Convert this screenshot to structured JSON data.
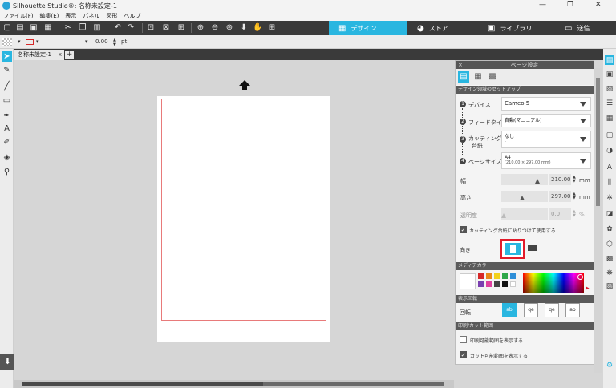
{
  "window": {
    "title": "Silhouette Studio®: 名称未設定-1",
    "minimize": "—",
    "restore": "❐",
    "close": "✕"
  },
  "menu": [
    "ファイル(F)",
    "編集(E)",
    "表示",
    "パネル",
    "図形",
    "ヘルプ"
  ],
  "nav_tabs": [
    {
      "label": "デザイン",
      "icon": "▦",
      "active": true
    },
    {
      "label": "ストア",
      "icon": "◕",
      "active": false
    },
    {
      "label": "ライブラリ",
      "icon": "▣",
      "active": false
    },
    {
      "label": "送信",
      "icon": "▭",
      "active": false
    }
  ],
  "options_bar": {
    "line_width": "0.00",
    "line_unit": "pt"
  },
  "document_tab": {
    "name": "名称未設定-1",
    "close": "x",
    "add": "+"
  },
  "page_setup": {
    "title": "ページ設定",
    "section_machine": "デザイン領域のセットアップ",
    "device_label": "デバイス",
    "device_value": "Cameo 5",
    "feed_label": "フィードタイプ",
    "feed_value": "自動(マニュアル)",
    "mat_label_1": "カッティング用",
    "mat_label_2": "台紙",
    "mat_value": "なし",
    "mat_sub": "-",
    "page_size_label": "ページサイズ",
    "page_size_value": "A4",
    "page_size_sub": "(210.00 × 297.00 mm)",
    "width_label": "幅",
    "width_value": "210.00",
    "width_unit": "mm",
    "width_knob_pct": 80,
    "height_label": "高さ",
    "height_value": "297.00",
    "height_unit": "mm",
    "height_knob_pct": 45,
    "transparency_label": "透明度",
    "transparency_value": "0.0",
    "transparency_unit": "%",
    "mat_checkbox_label": "カッティング台紙に貼りつけて使用する",
    "mat_checkbox_checked": true,
    "orientation_label": "向き",
    "section_media_color": "メディアカラー",
    "section_rotation": "表示回転",
    "rotation_label": "回転",
    "rotations": [
      "ab",
      "qe",
      "qe",
      "ap"
    ],
    "section_print_cut": "印刷/カット範囲",
    "print_area_label": "印刷可能範囲を表示する",
    "print_area_checked": false,
    "cut_area_label": "カット可能範囲を表示する",
    "cut_area_checked": true
  },
  "media_colors": [
    "#d62828",
    "#e88a1a",
    "#f2d21c",
    "#2ea84a",
    "#2f8fd8",
    "#7a3fb0",
    "#e040a0",
    "#444444",
    "#111111",
    "#ffffff"
  ],
  "colors": {
    "accent": "#29b6e0",
    "toolbar": "#3a3a3a",
    "highlight": "#e11b2a",
    "cut_line": "#e87a7a"
  }
}
